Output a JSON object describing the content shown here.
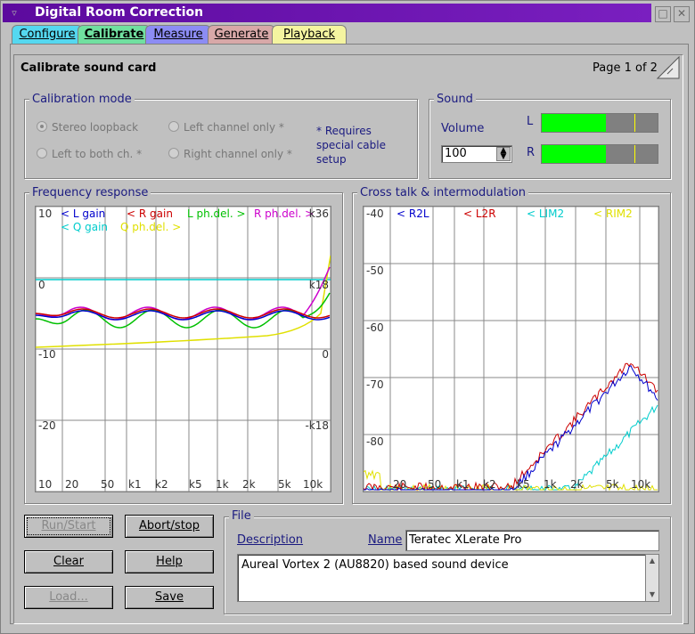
{
  "window": {
    "title": "Digital Room Correction"
  },
  "tabs": [
    {
      "label": "Configure",
      "color": "#55d8f0"
    },
    {
      "label": "Calibrate",
      "color": "#70e0a0"
    },
    {
      "label": "Measure",
      "color": "#8c8cf4"
    },
    {
      "label": "Generate",
      "color": "#d8a8a8"
    },
    {
      "label": "Playback",
      "color": "#f4f4a0"
    }
  ],
  "page": {
    "title": "Calibrate sound card",
    "pager": "Page 1 of 2"
  },
  "calibration_mode": {
    "label": "Calibration mode",
    "options": [
      "Stereo loopback",
      "Left channel only *",
      "Left to both ch. *",
      "Right channel only *"
    ],
    "selected": "Stereo loopback",
    "note": "* Requires special cable setup"
  },
  "sound": {
    "label": "Sound",
    "volume_label": "Volume",
    "volume_value": "100",
    "left_label": "L",
    "right_label": "R",
    "left_level": 0.55,
    "right_level": 0.55,
    "peak_marker": 0.8
  },
  "frequency_response": {
    "label": "Frequency response",
    "legend": [
      {
        "text": "< L gain",
        "color": "#0000cc"
      },
      {
        "text": "< R gain",
        "color": "#cc0000"
      },
      {
        "text": "L ph.del. >",
        "color": "#00c000"
      },
      {
        "text": "R ph.del. >",
        "color": "#cc00cc"
      },
      {
        "text": "< Q gain",
        "color": "#00cccc"
      },
      {
        "text": "Q ph.del. >",
        "color": "#e0e000"
      }
    ],
    "y_left_ticks": [
      "10",
      "0",
      "-10",
      "-20"
    ],
    "y_right_ticks": [
      "k36",
      "k18",
      "0",
      "-k18"
    ],
    "x_ticks": [
      "10",
      "20",
      "50",
      "k1",
      "k2",
      "k5",
      "1k",
      "2k",
      "5k",
      "10k"
    ]
  },
  "cross_talk": {
    "label": "Cross talk & intermodulation",
    "legend": [
      {
        "text": "< R2L",
        "color": "#0000cc"
      },
      {
        "text": "< L2R",
        "color": "#cc0000"
      },
      {
        "text": "< LIM2",
        "color": "#00cccc"
      },
      {
        "text": "< RIM2",
        "color": "#e0e000"
      }
    ],
    "y_ticks": [
      "-40",
      "-50",
      "-60",
      "-70",
      "-80"
    ],
    "x_ticks": [
      "20",
      "50",
      "k1",
      "k2",
      "k5",
      "1k",
      "2k",
      "5k",
      "10k"
    ]
  },
  "buttons": {
    "run": "Run/Start",
    "abort": "Abort/stop",
    "clear": "Clear",
    "help": "Help",
    "load": "Load...",
    "save": "Save"
  },
  "file": {
    "label": "File",
    "description_label": "Description",
    "name_label": "Name",
    "name_value": "Teratec XLerate Pro",
    "description_value": "Aureal Vortex 2 (AU8820) based sound device"
  }
}
